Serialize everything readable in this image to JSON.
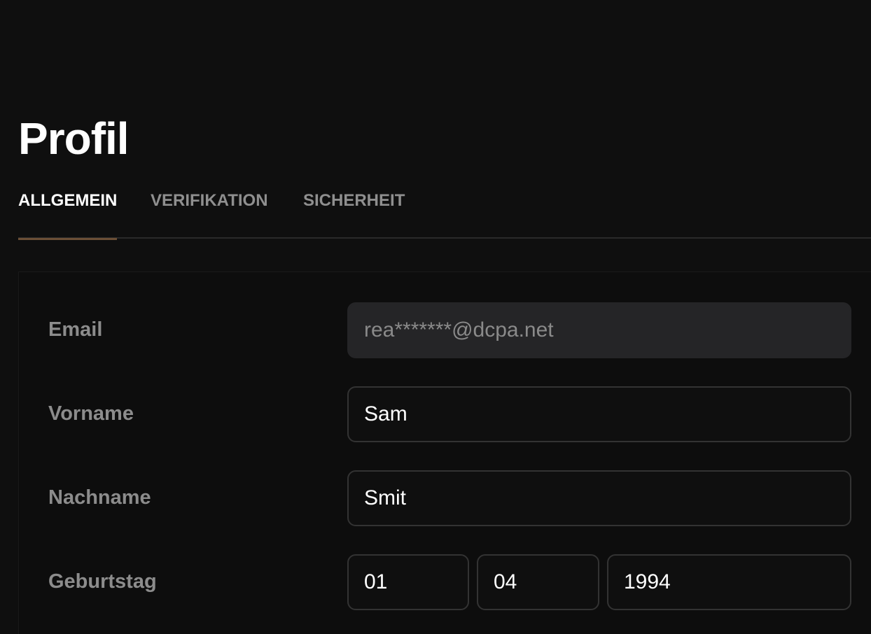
{
  "page": {
    "title": "Profil"
  },
  "tabs": [
    {
      "label": "ALLGEMEIN",
      "active": true
    },
    {
      "label": "VERIFIKATION",
      "active": false
    },
    {
      "label": "SICHERHEIT",
      "active": false
    }
  ],
  "form": {
    "email": {
      "label": "Email",
      "value": "rea*******@dcpa.net",
      "disabled": true
    },
    "first_name": {
      "label": "Vorname",
      "value": "Sam"
    },
    "last_name": {
      "label": "Nachname",
      "value": "Smit"
    },
    "birthday": {
      "label": "Geburtstag",
      "day": "01",
      "month": "04",
      "year": "1994"
    }
  },
  "colors": {
    "background": "#0f0f0f",
    "active_tab_underline": "#6b4f36",
    "label": "#8c8c8c",
    "disabled_input_bg": "#252527",
    "input_border": "#333333"
  }
}
